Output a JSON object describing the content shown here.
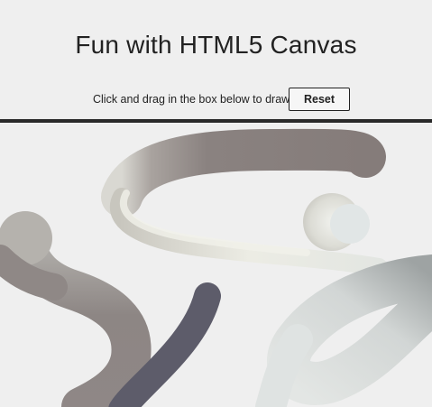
{
  "page": {
    "title": "Fun with HTML5 Canvas"
  },
  "toolbar": {
    "instruction": "Click and drag in the box below to draw!",
    "reset_label": "Reset"
  },
  "canvas": {
    "background": "#efefef",
    "stroke_colors": {
      "upper_loop": "#8a8280",
      "upper_loop_light": "#d7d7d0",
      "left_loop": "#9a9190",
      "dark_stroke": "#5d5c6a",
      "right_swirl": "#d3d7d7",
      "ball": "#e1e6e6"
    }
  }
}
